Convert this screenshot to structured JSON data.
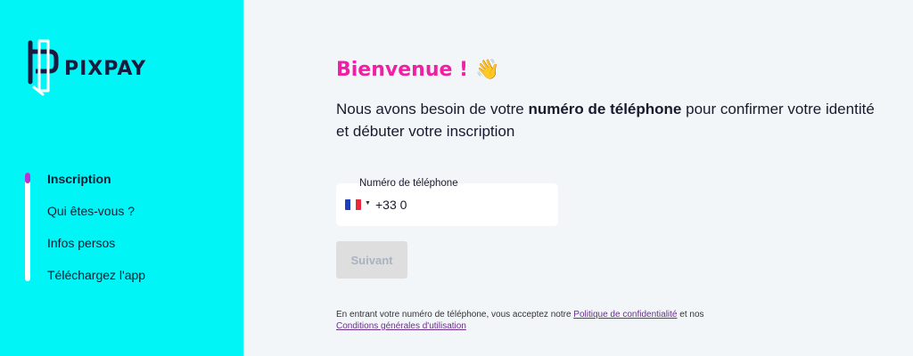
{
  "brand": {
    "name": "PIXPAY"
  },
  "sidebar": {
    "steps": [
      {
        "label": "Inscription",
        "active": true
      },
      {
        "label": "Qui êtes-vous ?",
        "active": false
      },
      {
        "label": "Infos persos",
        "active": false
      },
      {
        "label": "Téléchargez l'app",
        "active": false
      }
    ],
    "colors": {
      "background": "#00f5f7",
      "progress": "#b236d6"
    }
  },
  "main": {
    "title": "Bienvenue !",
    "title_icon": "waving-hand-icon",
    "intro_before": "Nous avons besoin de votre ",
    "intro_bold": "numéro de téléphone",
    "intro_after": " pour confirmer votre identité et débuter votre inscription",
    "phone": {
      "label": "Numéro de téléphone",
      "country": "france-flag-icon",
      "value": "+33 0"
    },
    "submit_label": "Suivant",
    "legal": {
      "before": "En entrant votre numéro de téléphone, vous acceptez notre ",
      "privacy_link": "Politique de confidentialité",
      "middle": " et nos ",
      "terms_link": "Conditions générales d'utilisation"
    },
    "colors": {
      "title": "#f01fa6",
      "link": "#6a2f8a"
    }
  }
}
